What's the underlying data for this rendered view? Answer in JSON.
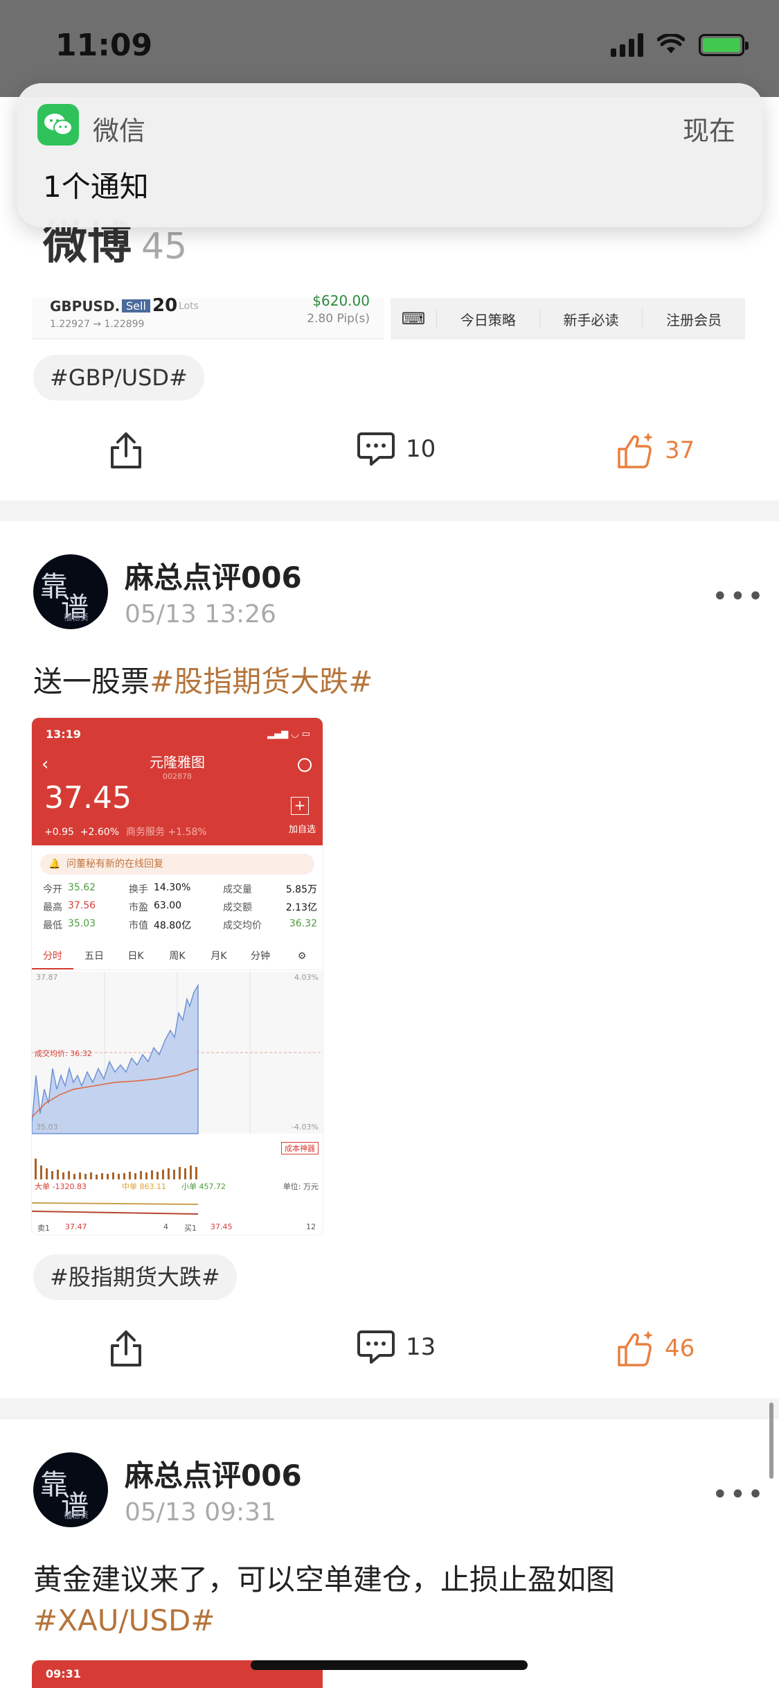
{
  "status_bar": {
    "time": "11:09"
  },
  "notification": {
    "app_name": "微信",
    "time": "现在",
    "body": "1个通知"
  },
  "post_prev": {
    "title_partial": "微博",
    "title_count": "45",
    "trade": {
      "pair": "GBPUSD.",
      "side": "Sell",
      "lots": "20",
      "lots_unit": "Lots",
      "amount": "$620.00",
      "range": "1.22927 → 1.22899",
      "pips": "2.80 Pip(s)"
    },
    "menu": [
      "今日策略",
      "新手必读",
      "注册会员"
    ],
    "tag": "#GBP/USD#",
    "comments": "10",
    "likes": "37"
  },
  "post1": {
    "avatar_text": [
      "靠",
      "谱",
      "福德贤"
    ],
    "author": "麻总点评006",
    "date": "05/13 13:26",
    "text": "送一股票",
    "text_tag": "#股指期货大跌#",
    "tag": "#股指期货大跌#",
    "comments": "13",
    "likes": "46",
    "stock": {
      "status_time": "13:19",
      "name": "元隆雅图",
      "code": "002878",
      "price": "37.45",
      "change": "+0.95",
      "change_pct": "+2.60%",
      "sector": "商务服务 +1.58%",
      "add_label": "加自选",
      "notice": "问董秘有新的在线回复",
      "stats": [
        {
          "k1": "今开",
          "v1": "35.62",
          "k2": "换手",
          "v2": "14.30%",
          "k3": "成交量",
          "v3": "5.85万"
        },
        {
          "k1": "最高",
          "v1": "37.56",
          "k2": "市盈",
          "v2": "63.00",
          "k3": "成交额",
          "v3": "2.13亿"
        },
        {
          "k1": "最低",
          "v1": "35.03",
          "k2": "市值",
          "v2": "48.80亿",
          "k3": "成交均价",
          "v3": "36.32"
        }
      ],
      "tabs": [
        "分时",
        "五日",
        "日K",
        "周K",
        "月K",
        "分钟",
        "⚙"
      ],
      "chart_labels": {
        "top": "37.87",
        "bottom": "35.03",
        "top_pct": "4.03%",
        "bottom_pct": "-4.03%",
        "avg": "成交均价: 36.32",
        "tool": "成本神器",
        "big": "大单 -1320.83",
        "mid": "中单 863.11",
        "small": "小单 457.72",
        "unit": "单位: 万元",
        "sell1": "卖1",
        "sell1_price": "37.47",
        "sell1_vol": "4",
        "buy1": "买1",
        "buy1_price": "37.45",
        "buy1_vol": "12"
      }
    }
  },
  "post2": {
    "avatar_text": [
      "靠",
      "谱",
      "福德贤"
    ],
    "author": "麻总点评006",
    "date": "05/13 09:31",
    "text": "黄金建议来了，可以空单建仓，止损止盈如图",
    "text_tag": "#XAU/USD#",
    "shot_time": "09:31"
  },
  "colors": {
    "accent": "#b5743a",
    "like": "#e9803f",
    "stock_red": "#d63c35"
  }
}
